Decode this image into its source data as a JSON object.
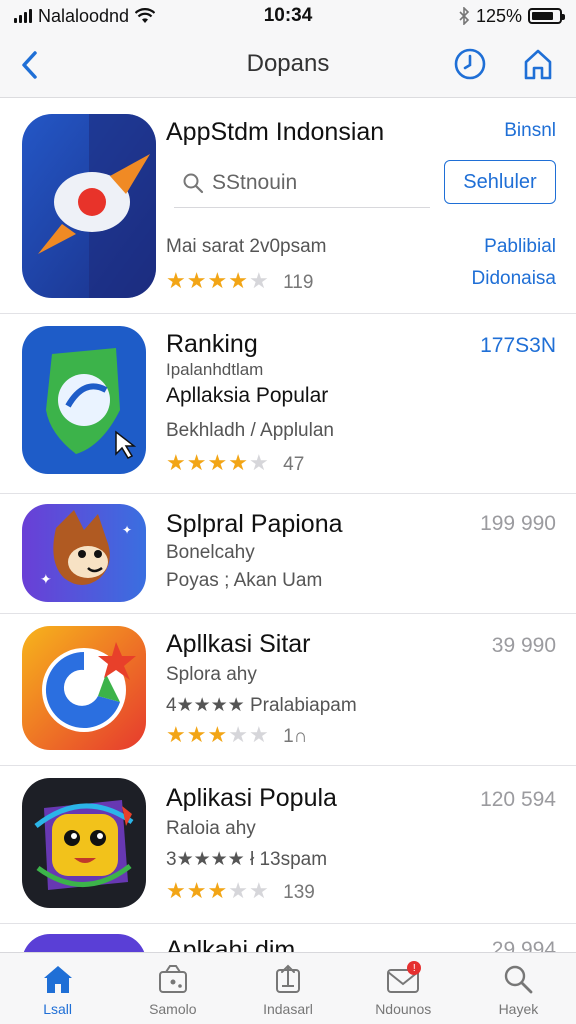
{
  "status_bar": {
    "carrier": "Nalaloodnd",
    "time": "10:34",
    "battery": "125%",
    "battery_level": 0.8
  },
  "nav": {
    "title": "Dopans",
    "back_icon": "chevron-left-icon",
    "right_icons": [
      "clock-icon",
      "home-icon"
    ]
  },
  "featured": {
    "title": "AppStdm Indonsian",
    "link": "Binsnl",
    "search_placeholder": "SStnouin",
    "search_button": "Sehluler",
    "meta": "Mai sarat 2v0psam",
    "rating": 4.5,
    "rating_count": "119",
    "right_top": "Pablibial",
    "right_bottom": "Didonaisa",
    "icon": "rocket-app-icon"
  },
  "apps": [
    {
      "title": "Ranking",
      "line1": "Ipalanhdtlam",
      "line2": "Apllaksia Popular",
      "line3": "Bekhladh / Applulan",
      "rating": 4.5,
      "rating_count": "47",
      "price": "177S3N",
      "price_color": "#1f6fd6",
      "icon": "shield-app-icon"
    },
    {
      "title": "Splpral Papiona",
      "line1": "Bonelcahy",
      "line2": "Poyas ; Akan Uam",
      "price": "199 990",
      "price_color": "#9b9b9f",
      "icon": "fox-app-icon"
    },
    {
      "title": "Apllkasi Sitar",
      "line1": "Splora ahy",
      "line2": "4★★★★ Pralabiapam",
      "rating": 3.5,
      "rating_count": "1∩",
      "price": "39 990",
      "price_color": "#9b9b9f",
      "icon": "swirl-app-icon"
    },
    {
      "title": "Aplikasi Popula",
      "line1": "Raloia ahy",
      "line2": "3★★★★ ł 13spam",
      "rating": 3.5,
      "rating_count": "139",
      "price": "120 594",
      "price_color": "#9b9b9f",
      "icon": "monster-app-icon"
    },
    {
      "title": "Aplkahi dim",
      "price": "29 994",
      "price_color": "#9b9b9f",
      "icon": "partial-app-icon"
    }
  ],
  "tabs": [
    {
      "label": "Lsall",
      "icon": "home-icon",
      "active": true
    },
    {
      "label": "Samolo",
      "icon": "gift-icon",
      "active": false
    },
    {
      "label": "Indasarl",
      "icon": "upload-icon",
      "active": false
    },
    {
      "label": "Ndounos",
      "icon": "mail-icon",
      "active": false,
      "badge": "!"
    },
    {
      "label": "Hayek",
      "icon": "search-icon",
      "active": false
    }
  ]
}
